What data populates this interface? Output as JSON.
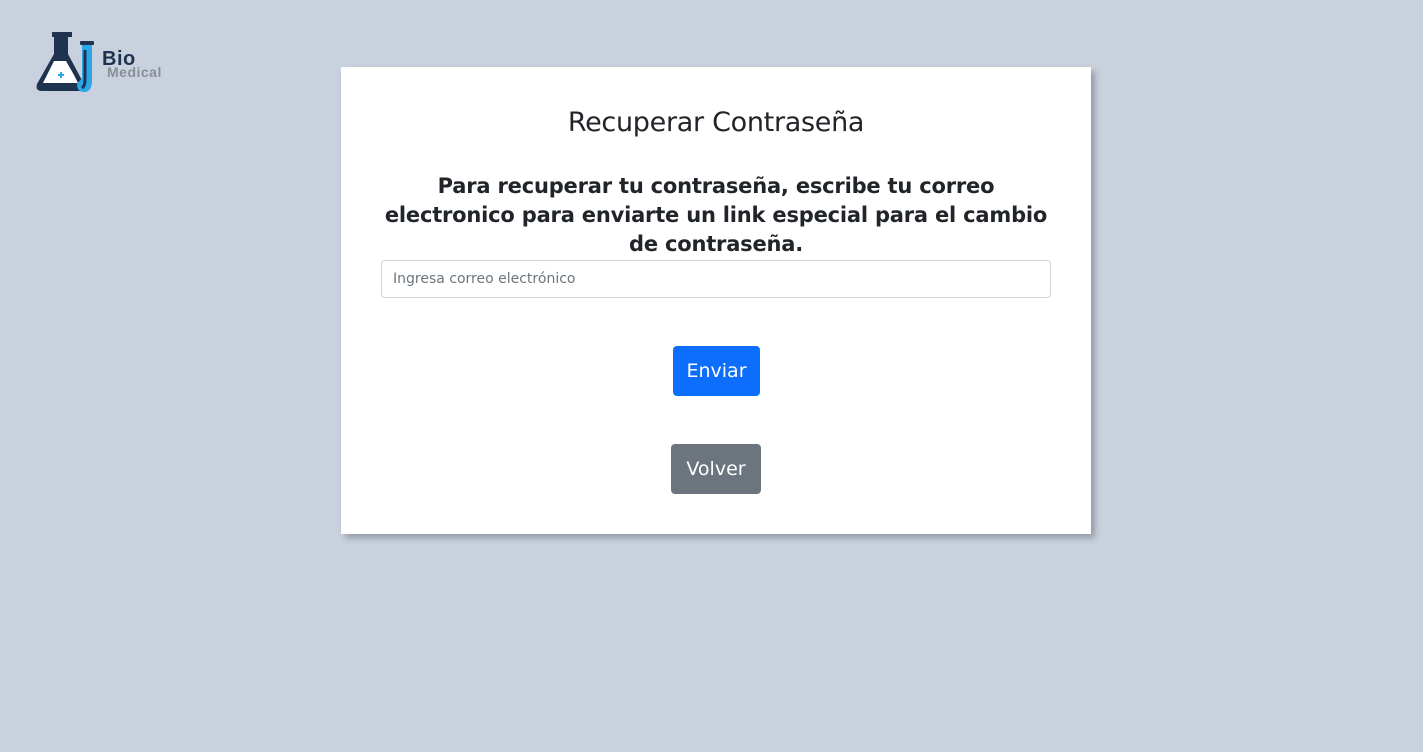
{
  "logo": {
    "brand_line1": "Bio",
    "brand_line2": "Medical",
    "icon": "flask-icon",
    "colors": {
      "dark": "#1f3350",
      "accent": "#2ba6e8",
      "gray": "#8a8f96"
    }
  },
  "form": {
    "title": "Recuperar Contraseña",
    "description": "Para recuperar tu contraseña, escribe tu correo electronico para enviarte un link especial para el cambio de contraseña.",
    "email": {
      "placeholder": "Ingresa correo electrónico",
      "value": ""
    },
    "submit_label": "Enviar",
    "back_label": "Volver"
  },
  "colors": {
    "background": "#c8d1dd",
    "primary": "#0d6efd",
    "secondary": "#6c757d"
  }
}
